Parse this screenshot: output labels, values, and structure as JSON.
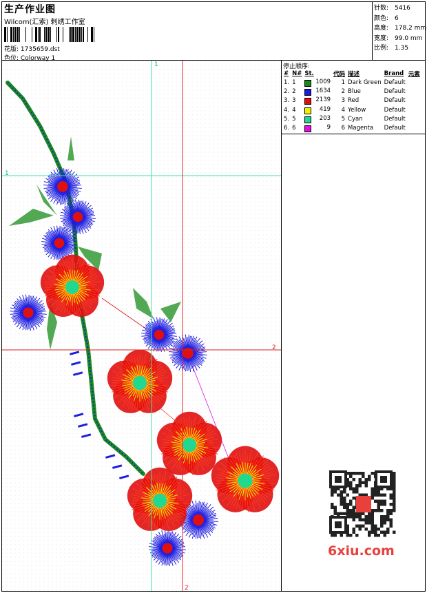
{
  "header": {
    "title": "生产作业图",
    "company": "Wilcom(汇索) 刺绣工作室",
    "pattern_label": "花版:",
    "pattern_file": "1735659.dst",
    "colorway_label": "色位:",
    "colorway_name": "Colorway 1"
  },
  "stats": [
    {
      "label": "针数:",
      "value": "5416"
    },
    {
      "label": "颜色:",
      "value": "6"
    },
    {
      "label": "高度:",
      "value": "178.2 mm"
    },
    {
      "label": "宽度:",
      "value": "99.0 mm"
    },
    {
      "label": "比例:",
      "value": "1.35"
    }
  ],
  "stop_sequence": {
    "title": "停止顺序:",
    "columns": [
      "#",
      "N#",
      "St.",
      "代码",
      "描述",
      "Brand",
      "元素"
    ],
    "rows": [
      {
        "idx": "1.",
        "n": "1",
        "st": "1009",
        "code": "1",
        "desc": "Dark Green",
        "brand": "Default",
        "color": "#1a8c1a"
      },
      {
        "idx": "2.",
        "n": "2",
        "st": "1634",
        "code": "2",
        "desc": "Blue",
        "brand": "Default",
        "color": "#1c1ce0"
      },
      {
        "idx": "3.",
        "n": "3",
        "st": "2139",
        "code": "3",
        "desc": "Red",
        "brand": "Default",
        "color": "#e01010"
      },
      {
        "idx": "4.",
        "n": "4",
        "st": "419",
        "code": "4",
        "desc": "Yellow",
        "brand": "Default",
        "color": "#f0f000"
      },
      {
        "idx": "5.",
        "n": "5",
        "st": "203",
        "code": "5",
        "desc": "Cyan",
        "brand": "Default",
        "color": "#20d890"
      },
      {
        "idx": "6.",
        "n": "6",
        "st": "9",
        "code": "6",
        "desc": "Magenta",
        "brand": "Default",
        "color": "#e010e0"
      }
    ]
  },
  "canvas": {
    "guide_labels": {
      "v1": "1",
      "h1": "1",
      "v2": "2",
      "h2": "2"
    },
    "guide_colors": {
      "green": "#40e0a0",
      "red": "#e02020"
    }
  },
  "watermark": {
    "text": "6xiu.com"
  }
}
